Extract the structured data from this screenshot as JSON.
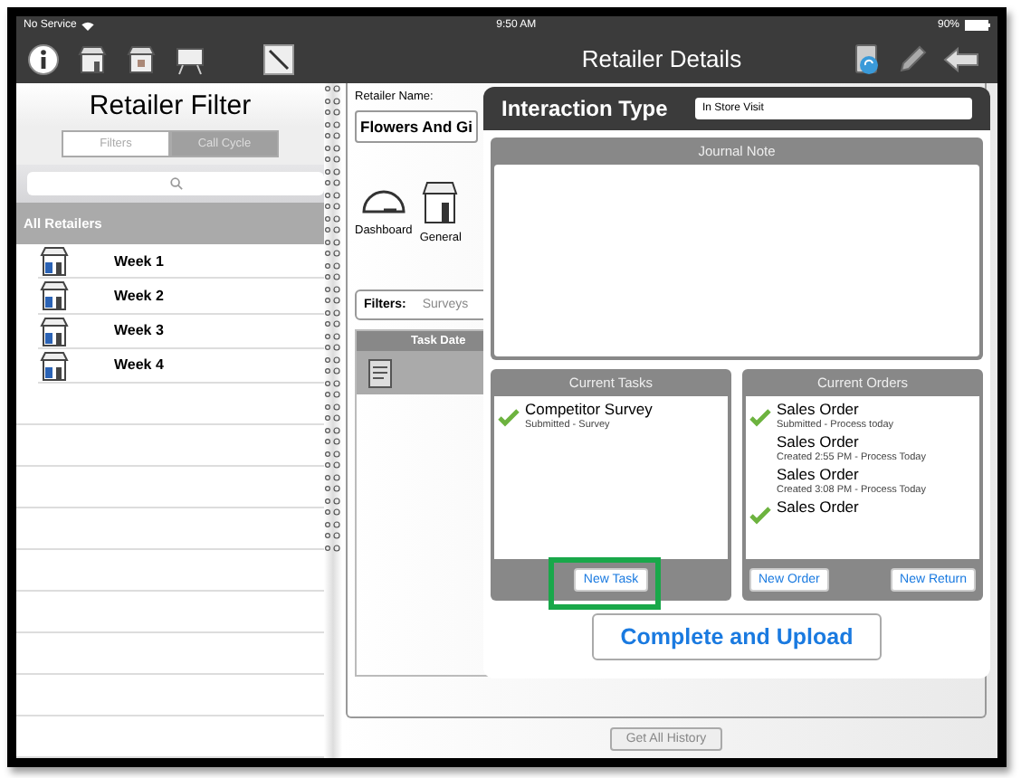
{
  "status_bar": {
    "carrier": "No Service",
    "time": "9:50 AM",
    "battery": "90%"
  },
  "nav_bar": {
    "title": "Retailer Details"
  },
  "sidebar": {
    "title": "Retailer Filter",
    "segments": [
      {
        "label": "Filters",
        "selected": false
      },
      {
        "label": "Call Cycle",
        "selected": true
      }
    ],
    "section": "All Retailers",
    "items": [
      {
        "label": "Week 1"
      },
      {
        "label": "Week 2"
      },
      {
        "label": "Week 3"
      },
      {
        "label": "Week 4"
      }
    ]
  },
  "retailer": {
    "name_label": "Retailer Name:",
    "name_value": "Flowers And Gi",
    "shortcuts": [
      {
        "kind": "dashboard",
        "label": "Dashboard"
      },
      {
        "kind": "store",
        "label": "General"
      }
    ],
    "filters_label": "Filters:",
    "filters_value": "Surveys",
    "table_header": "Task Date",
    "history_button": "Get All History"
  },
  "dialog": {
    "title": "Interaction Type",
    "type_value": "In Store Visit",
    "journal_header": "Journal Note",
    "tasks": {
      "header": "Current Tasks",
      "items": [
        {
          "title": "Competitor Survey",
          "subtitle": "Submitted - Survey",
          "checked": true
        }
      ],
      "buttons": [
        "New Task"
      ]
    },
    "orders": {
      "header": "Current Orders",
      "items": [
        {
          "title": "Sales Order",
          "subtitle": "Submitted - Process today",
          "checked": true
        },
        {
          "title": "Sales Order",
          "subtitle": "Created 2:55 PM - Process Today",
          "checked": false
        },
        {
          "title": "Sales Order",
          "subtitle": "Created 3:08 PM - Process Today",
          "checked": false
        },
        {
          "title": "Sales Order",
          "checked": true
        }
      ],
      "buttons": [
        "New Order",
        "New Return"
      ]
    },
    "complete_button": "Complete and Upload"
  }
}
